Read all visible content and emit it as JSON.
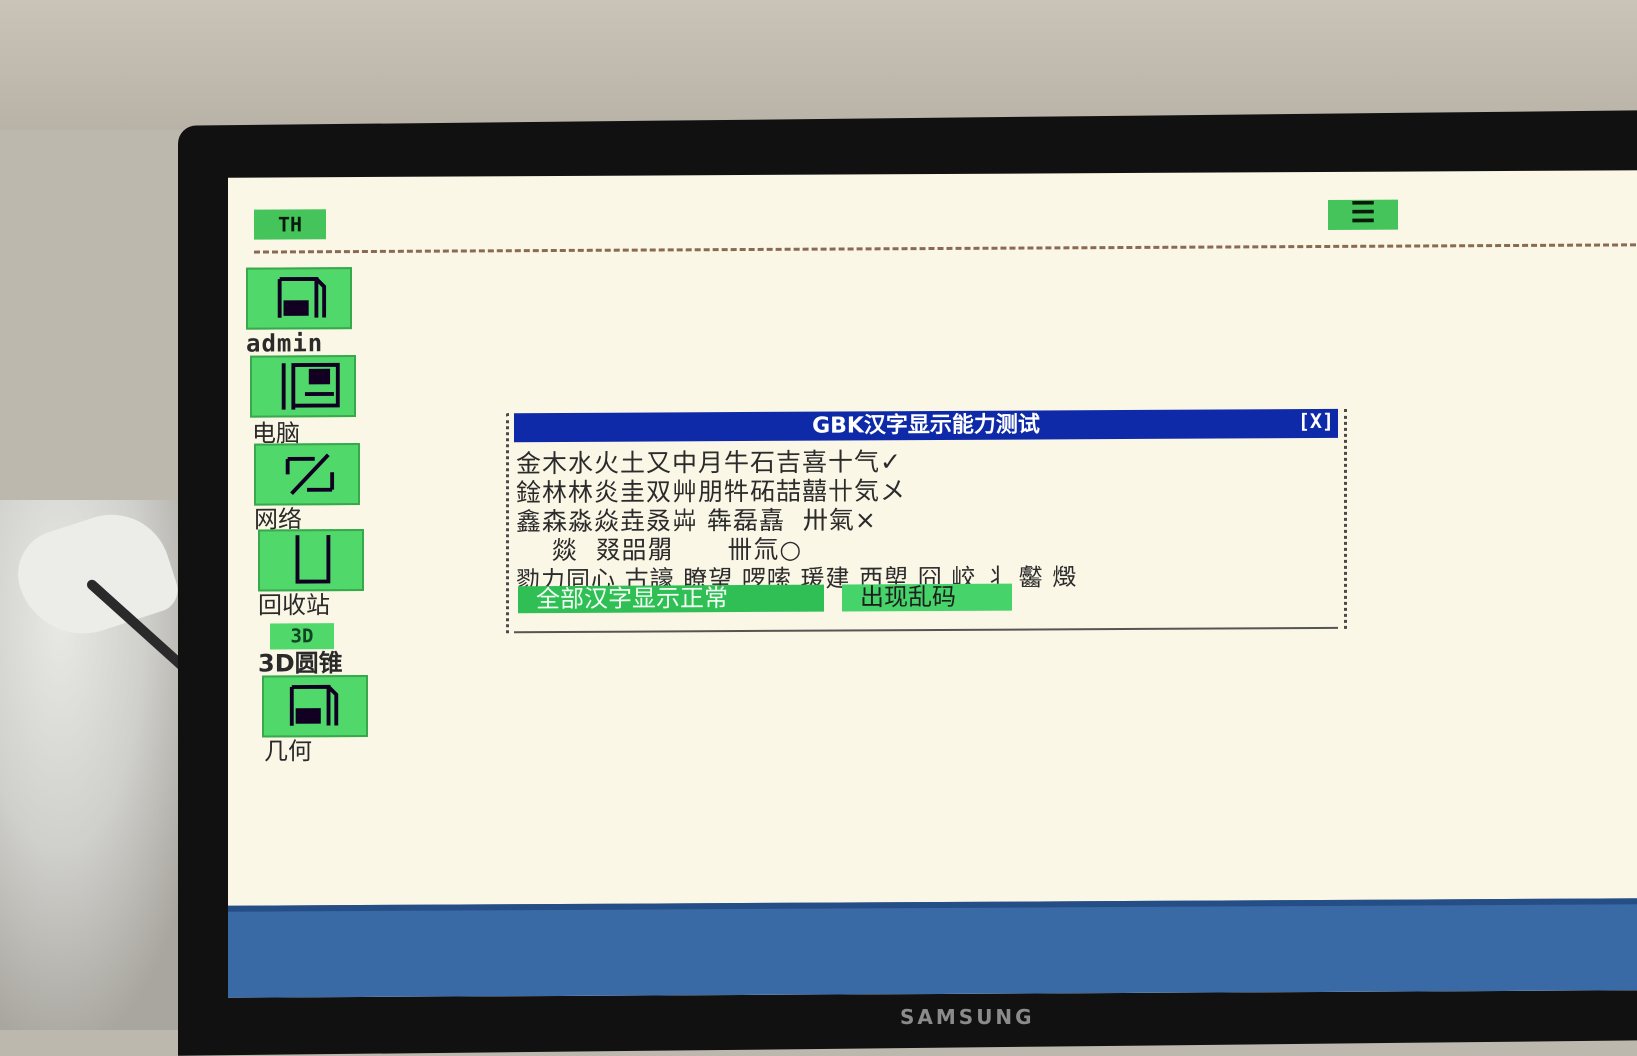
{
  "monitor": {
    "brand": "SAMSUNG"
  },
  "topbar": {
    "start_label": "TH",
    "menu_label": "☰"
  },
  "desktop": {
    "icons": [
      {
        "label": "admin"
      },
      {
        "label": "电脑"
      },
      {
        "label": "网络"
      },
      {
        "label": "回收站"
      },
      {
        "tag": "3D",
        "label": "3D圆锥"
      },
      {
        "label": "几何"
      }
    ]
  },
  "dialog": {
    "title": "GBK汉字显示能力测试",
    "close_label": "[X]",
    "lines": [
      "金木水火土又中月牛石吉喜十气✓",
      "鍂林林炎圭双艸朋牪砳喆囍卄気メ",
      "鑫森淼焱垚叒芔 犇磊嚞  卅氣×",
      "    燚  叕㗊朤      卌氚○",
      "勠力同心 古譹 瞭望 啰嗦 瑗建 西塱 囧 峧 丬 齾 燬"
    ],
    "buttons": {
      "ok_label": "全部汉字显示正常",
      "garbled_label": "出现乱码"
    }
  },
  "colors": {
    "title_bar": "#0f2aa8",
    "accent_green": "#45c45b",
    "taskbar": "#3a6aa6",
    "screen_bg": "#fbf7e6"
  }
}
